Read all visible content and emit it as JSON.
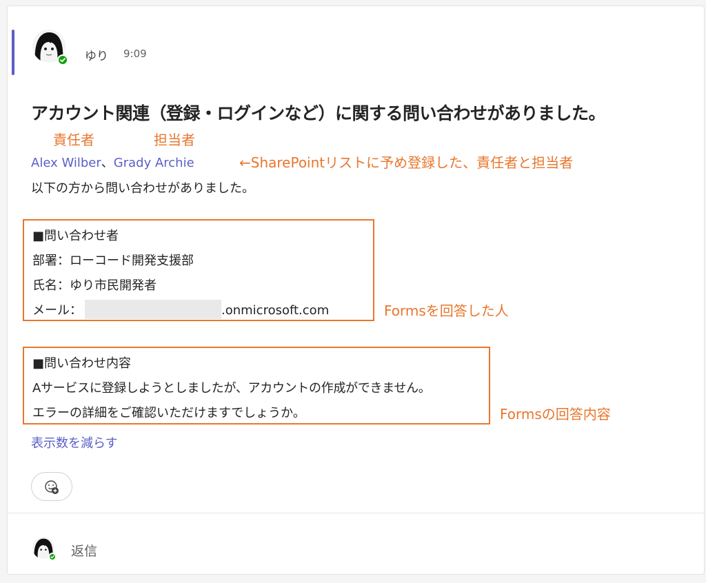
{
  "message": {
    "sender": "ゆり",
    "time": "9:09",
    "subject": "アカウント関連（登録・ログインなど）に関する問い合わせがありました。",
    "mentions": [
      "Alex Wilber",
      "Grady Archie"
    ],
    "mention_separator": "、",
    "intro": "以下の方から問い合わせがありました。",
    "inquirer_box": {
      "heading": "■問い合わせ者",
      "department": "部署：ローコード開発支援部",
      "name": "氏名：ゆり市民開発者",
      "mail_label": "メール：",
      "mail_domain": ".onmicrosoft.com"
    },
    "content_box": {
      "heading": "■問い合わせ内容",
      "line1": "Aサービスに登録しようとしましたが、アカウントの作成ができません。",
      "line2": "エラーの詳細をご確認いただけますでしょうか。"
    },
    "show_less": "表示数を減らす"
  },
  "annotations": {
    "responsible": "責任者",
    "in_charge": "担当者",
    "sharepoint_note": "←SharePointリストに予め登録した、責任者と担当者",
    "forms_respondent": "Formsを回答した人",
    "forms_content": "Formsの回答内容"
  },
  "reply": {
    "label": "返信"
  },
  "colors": {
    "accent": "#5b5fc7",
    "annotation": "#e8762c",
    "presence": "#13a10e"
  },
  "icons": {
    "reaction": "emoji-add-icon",
    "presence": "available-check-icon"
  }
}
